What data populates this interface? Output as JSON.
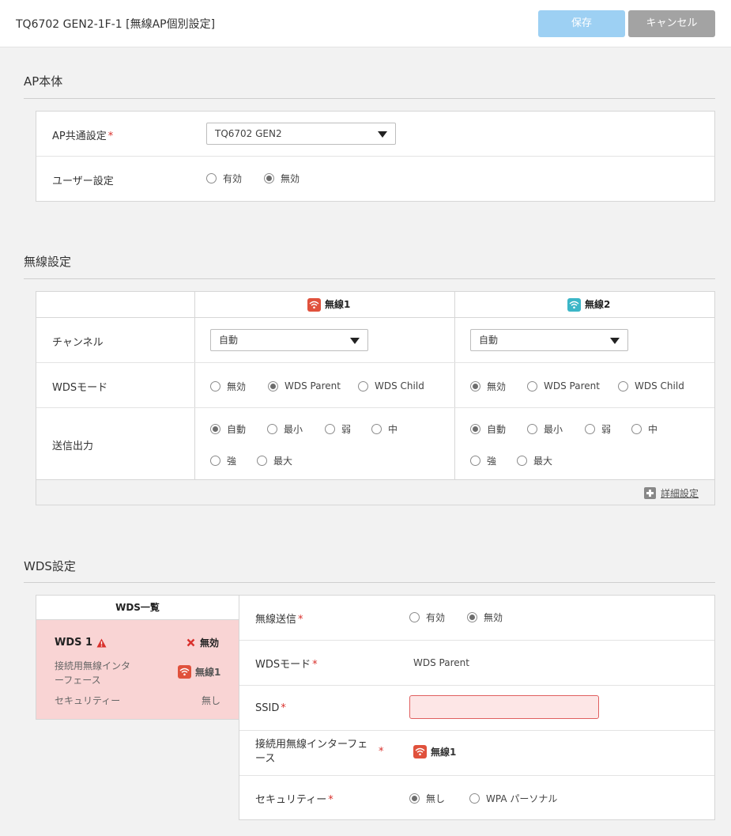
{
  "header": {
    "title": "TQ6702 GEN2-1F-1 [無線AP個別設定]",
    "save_label": "保存",
    "cancel_label": "キャンセル"
  },
  "colors": {
    "save_button": "#9dd0f3",
    "cancel_button": "#a3a3a3",
    "wireless1": "#e0513c",
    "wireless2": "#3bb6c7",
    "error_bg": "#f9d4d4",
    "required": "#d9302c"
  },
  "ap_section": {
    "title": "AP本体",
    "common_label": "AP共通設定",
    "required_mark": "*",
    "common_value": "TQ6702 GEN2",
    "user_label": "ユーザー設定",
    "user_options": [
      "有効",
      "無効"
    ],
    "user_selected": "無効"
  },
  "wireless_section": {
    "title": "無線設定",
    "col1": "無線1",
    "col2": "無線2",
    "channel_label": "チャンネル",
    "channel1": "自動",
    "channel2": "自動",
    "wds_label": "WDSモード",
    "wds_options": [
      "無効",
      "WDS Parent",
      "WDS Child"
    ],
    "wds1_selected": "WDS Parent",
    "wds2_selected": "無効",
    "power_label": "送信出力",
    "power_options": [
      "自動",
      "最小",
      "弱",
      "中",
      "強",
      "最大"
    ],
    "power1_selected": "自動",
    "power2_selected": "自動",
    "detail_link": "詳細設定"
  },
  "wds_section": {
    "title": "WDS設定",
    "list_title": "WDS一覧",
    "card": {
      "name": "WDS 1",
      "status": "無効",
      "iface_label": "接続用無線インターフェース",
      "iface_value": "無線1",
      "security_label": "セキュリティー",
      "security_value": "無し"
    },
    "form": {
      "transmit_label": "無線送信",
      "transmit_options": [
        "有効",
        "無効"
      ],
      "transmit_selected": "無効",
      "mode_label": "WDSモード",
      "mode_value": "WDS Parent",
      "ssid_label": "SSID",
      "ssid_value": "",
      "iface_label": "接続用無線インターフェース",
      "iface_value": "無線1",
      "security_label": "セキュリティー",
      "security_options": [
        "無し",
        "WPA パーソナル"
      ],
      "security_selected": "無し",
      "required_mark": "*"
    }
  }
}
